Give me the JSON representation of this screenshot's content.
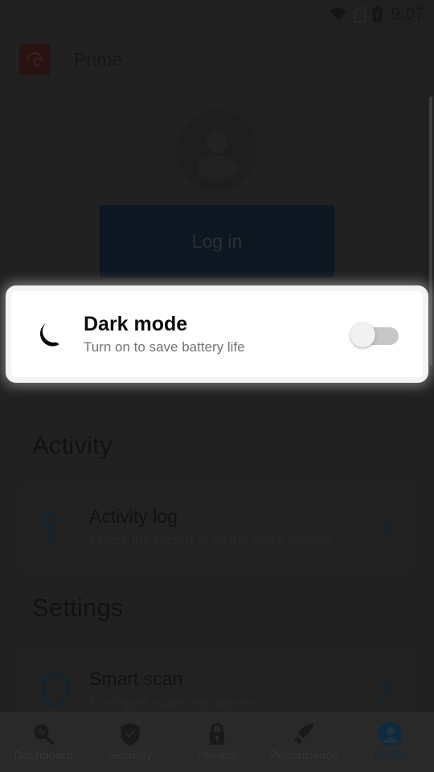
{
  "status_bar": {
    "time": "9:07",
    "icons": [
      "wifi-icon",
      "sim-missing-icon",
      "battery-charging-icon"
    ]
  },
  "app_bar": {
    "logo_icon": "avira-umbrella-logo",
    "title": "Prime"
  },
  "profile_header": {
    "avatar_icon": "avatar-placeholder-icon",
    "login_label": "Log in"
  },
  "sections": {
    "activity": {
      "title": "Activity",
      "rows": [
        {
          "icon": "activity-log-icon",
          "title": "Activity log",
          "subtitle": "Check the record of all the app's actions",
          "chevron": "chevron-right-icon"
        }
      ]
    },
    "settings": {
      "title": "Settings",
      "rows": [
        {
          "icon": "shield-icon",
          "title": "Smart scan",
          "subtitle": "Configure scanning options",
          "chevron": "chevron-right-icon"
        }
      ]
    }
  },
  "spotlight": {
    "icon": "crescent-moon-icon",
    "title": "Dark mode",
    "subtitle": "Turn on to save battery life",
    "toggle_state": "off"
  },
  "bottom_nav": {
    "items": [
      {
        "label": "Dashboard",
        "icon": "dashboard-scan-icon",
        "active": false
      },
      {
        "label": "Security",
        "icon": "shield-check-icon",
        "active": false
      },
      {
        "label": "Privacy",
        "icon": "lock-icon",
        "active": false
      },
      {
        "label": "Performance",
        "icon": "rocket-icon",
        "active": false
      },
      {
        "label": "Profile",
        "icon": "avatar-icon",
        "active": true
      }
    ]
  },
  "colors": {
    "brand_red": "#4a1213",
    "accent_blue": "#0c3c5e",
    "overlay": "#121212",
    "card_white": "#ffffff"
  }
}
